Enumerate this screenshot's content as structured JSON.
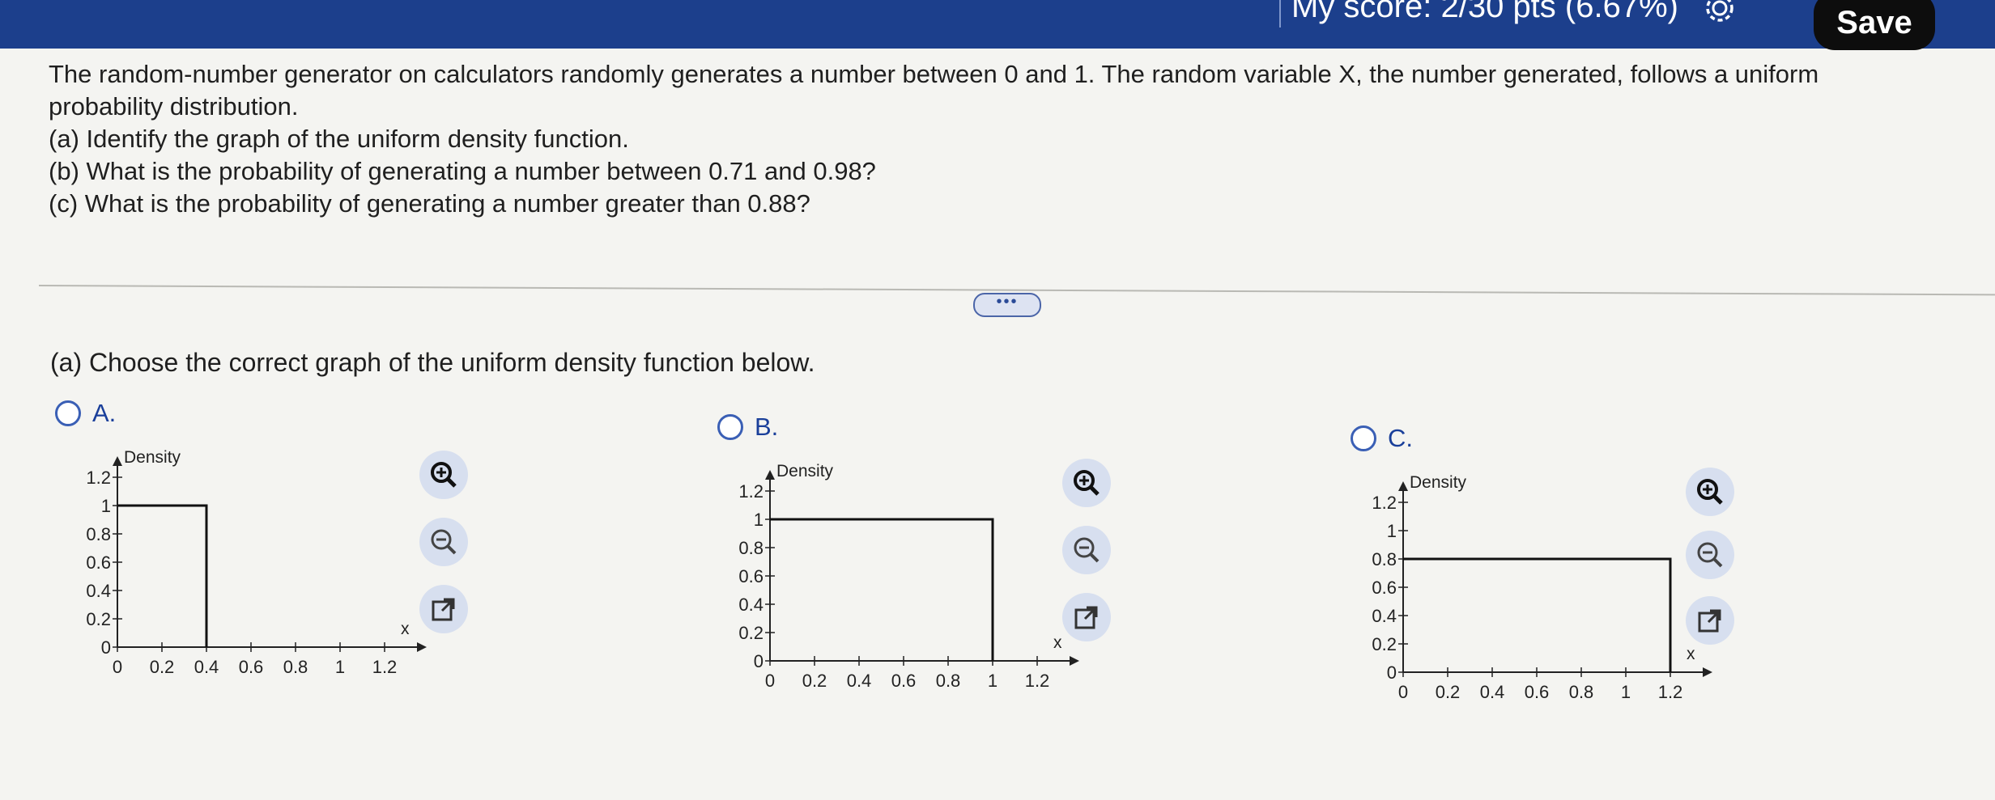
{
  "header": {
    "score_text": "My score: 2/30 pts (6.67%)",
    "save_label": "Save"
  },
  "problem": {
    "intro": "The random-number generator on calculators randomly generates a number between 0 and 1. The random variable X, the number generated, follows a uniform probability distribution.",
    "part_a": "(a) Identify the graph of the uniform density function.",
    "part_b": "(b) What is the probability of generating a number between 0.71 and 0.98?",
    "part_c": "(c) What is the probability of generating a number greater than 0.88?"
  },
  "divider": {
    "expand_label": "•••"
  },
  "question_a": {
    "prompt": "(a) Choose the correct graph of the uniform density function below.",
    "options": [
      {
        "letter": "A.",
        "selected": false
      },
      {
        "letter": "B.",
        "selected": false
      },
      {
        "letter": "C.",
        "selected": false
      }
    ]
  },
  "chart_data": [
    {
      "type": "line",
      "ylabel": "Density",
      "xlabel": "x",
      "xlim": [
        0,
        1.2
      ],
      "ylim": [
        0,
        1.2
      ],
      "x_ticks": [
        "0",
        "0.2",
        "0.4",
        "0.6",
        "0.8",
        "1",
        "1.2"
      ],
      "y_ticks": [
        "0",
        "0.2",
        "0.4",
        "0.6",
        "0.8",
        "1",
        "1.2"
      ],
      "series": [
        {
          "x": [
            0,
            0.4,
            0.4
          ],
          "y": [
            1,
            1,
            0
          ]
        }
      ]
    },
    {
      "type": "line",
      "ylabel": "Density",
      "xlabel": "x",
      "xlim": [
        0,
        1.2
      ],
      "ylim": [
        0,
        1.2
      ],
      "x_ticks": [
        "0",
        "0.2",
        "0.4",
        "0.6",
        "0.8",
        "1",
        "1.2"
      ],
      "y_ticks": [
        "0",
        "0.2",
        "0.4",
        "0.6",
        "0.8",
        "1",
        "1.2"
      ],
      "series": [
        {
          "x": [
            0,
            1,
            1
          ],
          "y": [
            1,
            1,
            0
          ]
        }
      ]
    },
    {
      "type": "line",
      "ylabel": "Density",
      "xlabel": "x",
      "xlim": [
        0,
        1.2
      ],
      "ylim": [
        0,
        1.2
      ],
      "x_ticks": [
        "0",
        "0.2",
        "0.4",
        "0.6",
        "0.8",
        "1",
        "1.2"
      ],
      "y_ticks": [
        "0",
        "0.2",
        "0.4",
        "0.6",
        "0.8",
        "1",
        "1.2"
      ],
      "series": [
        {
          "x": [
            0,
            1.2,
            1.2
          ],
          "y": [
            0.8,
            0.8,
            0
          ]
        }
      ]
    }
  ],
  "tools": {
    "zoom_in_icon": "magnifier-plus-icon",
    "zoom_out_icon": "magnifier-minus-icon",
    "popout_icon": "open-external-icon"
  },
  "colors": {
    "header": "#1c3f8c",
    "accent": "#3a5fb5",
    "save_button": "#0d0d0d"
  }
}
